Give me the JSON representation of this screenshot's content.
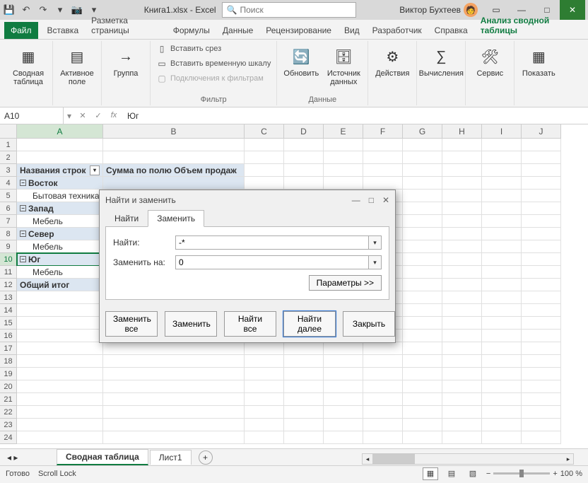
{
  "title": {
    "filename": "Книга1.xlsx",
    "appname": "Excel",
    "search_placeholder": "Поиск",
    "username": "Виктор Бухтеев"
  },
  "tabs": {
    "file": "Файл",
    "insert": "Вставка",
    "page_layout": "Разметка страницы",
    "formulas": "Формулы",
    "data": "Данные",
    "review": "Рецензирование",
    "view": "Вид",
    "developer": "Разработчик",
    "help": "Справка",
    "pivot_analyze": "Анализ сводной таблицы"
  },
  "ribbon": {
    "pivot_table": "Сводная\nтаблица",
    "active_field": "Активное\nполе",
    "group": "Группа",
    "insert_slicer": "Вставить срез",
    "insert_timeline": "Вставить временную шкалу",
    "filter_connections": "Подключения к фильтрам",
    "filter": "Фильтр",
    "refresh": "Обновить",
    "data_source": "Источник\nданных",
    "data_group": "Данные",
    "actions": "Действия",
    "calculations": "Вычисления",
    "tools": "Сервис",
    "show": "Показать"
  },
  "namebox": {
    "ref": "A10",
    "formula": "Юг"
  },
  "columns": [
    "A",
    "B",
    "C",
    "D",
    "E",
    "F",
    "G",
    "H",
    "I",
    "J"
  ],
  "rows": [
    {
      "n": 1,
      "cells": [
        "",
        ""
      ]
    },
    {
      "n": 2,
      "cells": [
        "",
        ""
      ]
    },
    {
      "n": 3,
      "cells": [
        "Названия строк",
        "Сумма по полю Объем продаж"
      ],
      "hdr": true
    },
    {
      "n": 4,
      "cells": [
        "Восток",
        ""
      ],
      "grp": true
    },
    {
      "n": 5,
      "cells": [
        "Бытовая техника",
        ""
      ],
      "ind": true
    },
    {
      "n": 6,
      "cells": [
        "Запад",
        ""
      ],
      "grp": true
    },
    {
      "n": 7,
      "cells": [
        "Мебель",
        ""
      ],
      "ind": true
    },
    {
      "n": 8,
      "cells": [
        "Север",
        ""
      ],
      "grp": true
    },
    {
      "n": 9,
      "cells": [
        "Мебель",
        ""
      ],
      "ind": true
    },
    {
      "n": 10,
      "cells": [
        "Юг",
        ""
      ],
      "grp": true,
      "sel": true
    },
    {
      "n": 11,
      "cells": [
        "Мебель",
        ""
      ],
      "ind": true
    },
    {
      "n": 12,
      "cells": [
        "Общий итог",
        ""
      ],
      "tot": true
    },
    {
      "n": 13
    },
    {
      "n": 14
    },
    {
      "n": 15
    },
    {
      "n": 16
    },
    {
      "n": 17
    },
    {
      "n": 18
    },
    {
      "n": 19
    },
    {
      "n": 20
    },
    {
      "n": 21
    },
    {
      "n": 22
    },
    {
      "n": 23
    },
    {
      "n": 24
    }
  ],
  "sheets": {
    "active": "Сводная таблица",
    "other": "Лист1"
  },
  "status": {
    "ready": "Готово",
    "scroll_lock": "Scroll Lock",
    "zoom": "100 %"
  },
  "dialog": {
    "title": "Найти и заменить",
    "tab_find": "Найти",
    "tab_replace": "Заменить",
    "find_label": "Найти:",
    "replace_label": "Заменить на:",
    "find_value": "-*",
    "replace_value": "0",
    "params_button": "Параметры >>",
    "replace_all": "Заменить все",
    "replace_one": "Заменить",
    "find_all": "Найти все",
    "find_next": "Найти далее",
    "close": "Закрыть"
  }
}
